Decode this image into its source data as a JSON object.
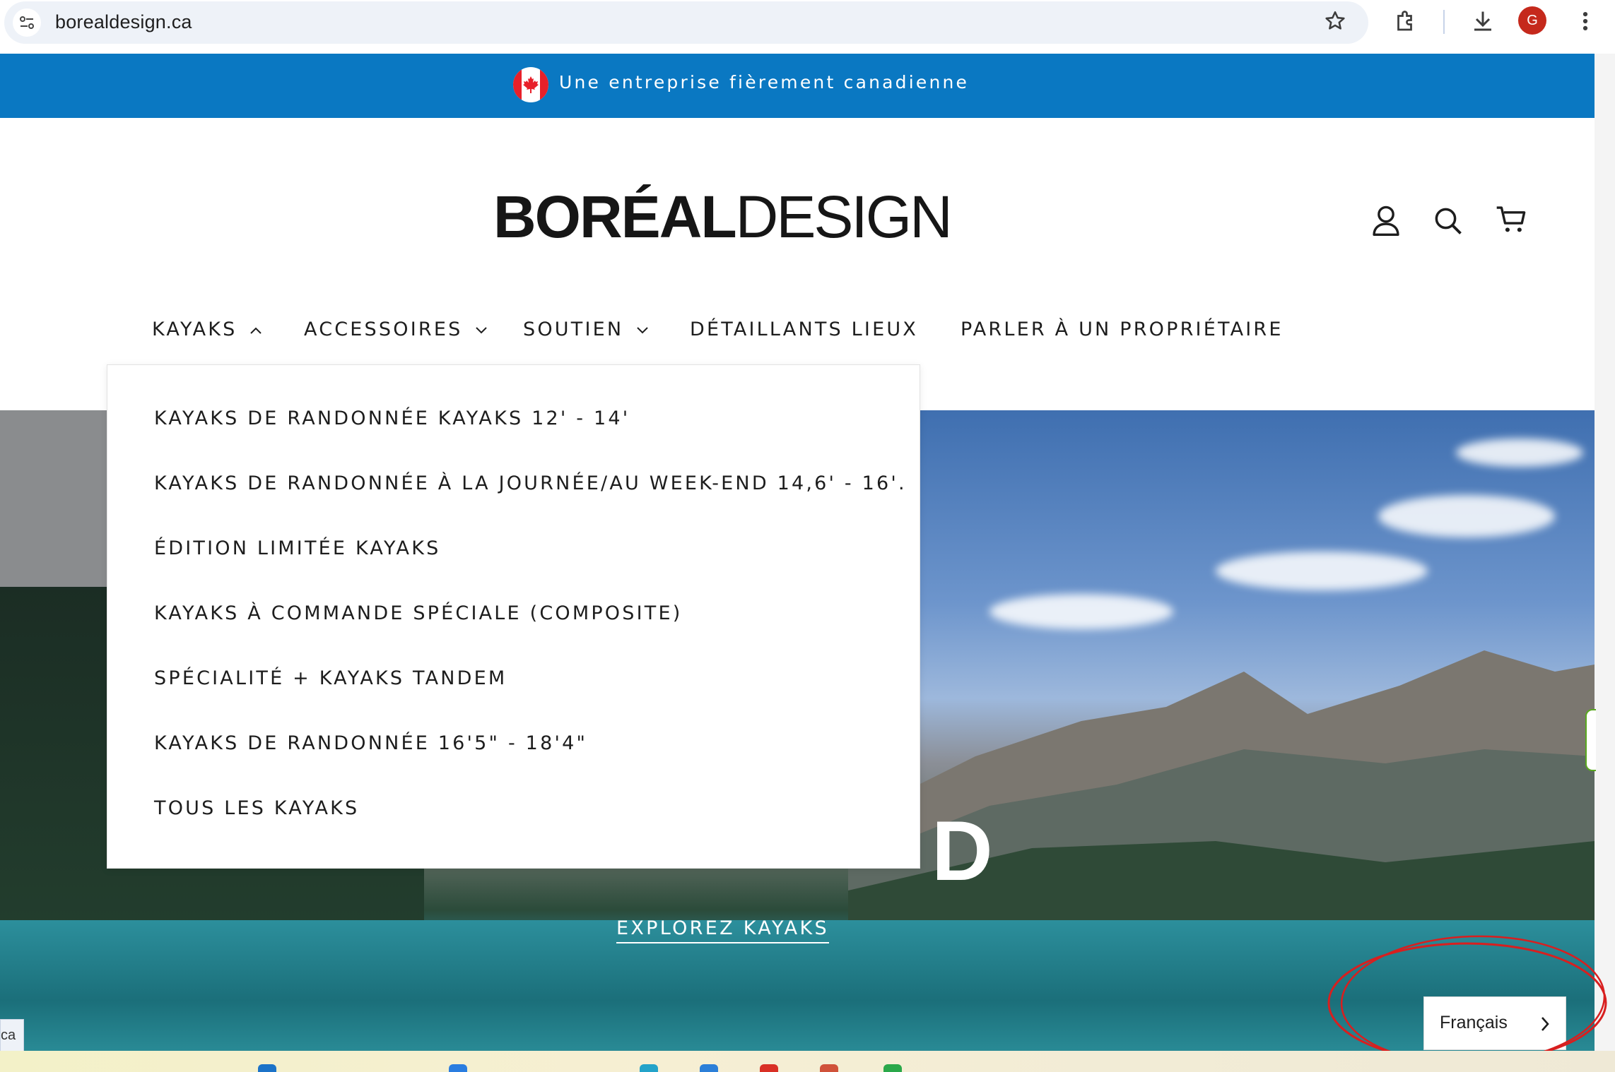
{
  "browser": {
    "url": "borealdesign.ca",
    "avatar_initial": "G",
    "icons": [
      "site-info-icon",
      "bookmark-star-icon",
      "extensions-icon",
      "download-icon",
      "more-vert-icon"
    ]
  },
  "announcement": {
    "text": "Une entreprise fièrement canadienne",
    "color": "#0a78c2"
  },
  "header": {
    "logo_strong": "BORÉAL",
    "logo_light": "DESIGN",
    "icons": [
      "account-icon",
      "search-icon",
      "cart-icon"
    ]
  },
  "nav": {
    "items": [
      {
        "label": "KAYAKS",
        "expanded": true
      },
      {
        "label": "ACCESSOIRES",
        "expanded": false
      },
      {
        "label": "SOUTIEN",
        "expanded": false
      },
      {
        "label": "DÉTAILLANTS LIEUX"
      },
      {
        "label": "PARLER À UN PROPRIÉTAIRE"
      }
    ]
  },
  "dropdown": {
    "items": [
      "KAYAKS DE RANDONNÉE KAYAKS 12' - 14'",
      "KAYAKS DE RANDONNÉE À LA JOURNÉE/AU WEEK-END 14,6' - 16'.",
      "ÉDITION LIMITÉE KAYAKS",
      "KAYAKS À COMMANDE SPÉCIALE (COMPOSITE)",
      "SPÉCIALITÉ + KAYAKS TANDEM",
      "KAYAKS DE RANDONNÉE 16'5\" - 18'4\"",
      "TOUS LES KAYAKS"
    ]
  },
  "hero": {
    "partial_heading": "D",
    "cta": "EXPLOREZ KAYAKS"
  },
  "language_switcher": {
    "label": "Français",
    "annotation_color": "#d81f1f"
  },
  "edge": {
    "tab_fragment": "ca"
  }
}
